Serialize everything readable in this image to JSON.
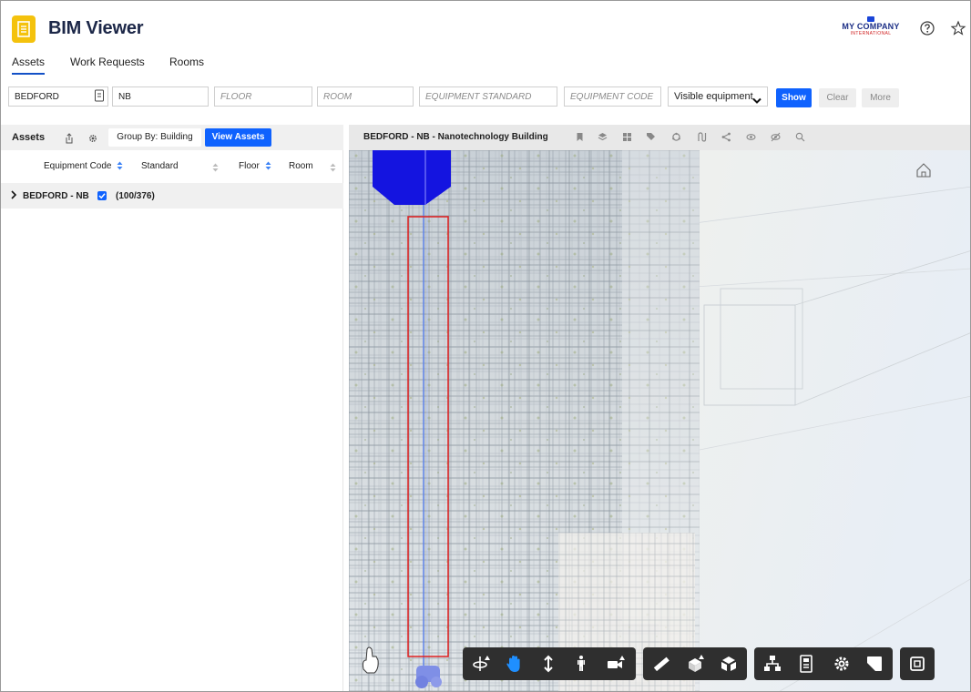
{
  "app": {
    "title": "BIM Viewer",
    "icon": "floor-plan-icon"
  },
  "company": {
    "name": "MY COMPANY",
    "sub": "INTERNATIONAL"
  },
  "tabs": [
    {
      "label": "Assets",
      "active": true
    },
    {
      "label": "Work Requests",
      "active": false
    },
    {
      "label": "Rooms",
      "active": false
    }
  ],
  "filters": {
    "site": "BEDFORD",
    "building": "NB",
    "floor_placeholder": "FLOOR",
    "room_placeholder": "ROOM",
    "equipment_standard_placeholder": "EQUIPMENT STANDARD",
    "equipment_code_placeholder": "EQUIPMENT CODE",
    "visibility_select": "Visible equipment",
    "show_label": "Show",
    "clear_label": "Clear",
    "more_label": "More"
  },
  "assets_panel": {
    "title": "Assets",
    "group_by_label": "Group By: Building",
    "view_assets_label": "View Assets",
    "columns": [
      "Equipment Code",
      "Standard",
      "Floor",
      "Room"
    ],
    "tree": [
      {
        "label": "BEDFORD - NB",
        "checked": true,
        "count": "(100/376)"
      }
    ]
  },
  "viewer": {
    "title": "BEDFORD - NB - Nanotechnology Building",
    "header_icons": [
      "bookmark-icon",
      "layers-icon",
      "grid-icon",
      "tag-icon",
      "cycle-icon",
      "path-icon",
      "share-icon",
      "hide-icon",
      "show-icon",
      "search-icon"
    ],
    "toolbar_groups": [
      [
        "orbit-icon",
        "pan-icon",
        "dolly-icon",
        "walk-icon",
        "camera-icon"
      ],
      [
        "measure-icon",
        "section-icon",
        "explode-icon"
      ],
      [
        "model-browser-icon",
        "properties-icon",
        "settings-icon",
        "fullscreen-icon"
      ],
      [
        "minimap-icon"
      ]
    ]
  },
  "colors": {
    "accent": "#0f62fe",
    "title": "#1c2748",
    "app_icon": "#f4c20d",
    "highlight": "#e02020",
    "selected_element": "#1414e0"
  }
}
